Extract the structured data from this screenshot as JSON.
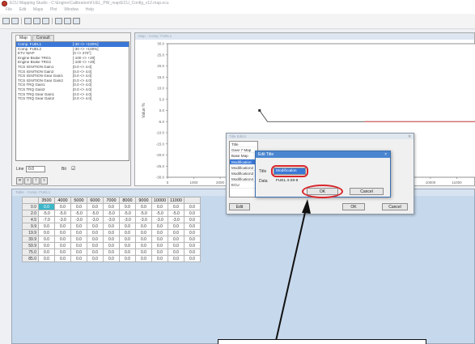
{
  "titlebar": {
    "title": "ECU Mapping Studio - C:\\Engine\\Calibration\\FUEL_PW_map\\ECU_Config_v12.map.ecu"
  },
  "menubar": {
    "items": [
      "File",
      "Edit",
      "Maps",
      "Plot",
      "Window",
      "Help"
    ]
  },
  "left_panel": {
    "tabs": [
      "Map",
      "Consult"
    ],
    "map_list": [
      {
        "name": "Comp. FUEL1",
        "range": "[-30 <> +100%]",
        "selected": true
      },
      {
        "name": "Comp. FUEL2",
        "range": "[-30 <> +100%]"
      },
      {
        "name": "ETV WAP",
        "range": "[0 <> 270°]"
      },
      {
        "name": "Engine Brake TRG1",
        "range": "[-100 <> +20]"
      },
      {
        "name": "Engine Brake TRG2",
        "range": "[-100 <> +20]"
      },
      {
        "name": "TCS IGNITION Gain1",
        "range": "[0.0 <> 4.0]"
      },
      {
        "name": "TCS IGNITION Gain2",
        "range": "[0.0 <> 4.0]"
      },
      {
        "name": "TCS IGNITION Gear Gain1",
        "range": "[0.0 <> 4.0]"
      },
      {
        "name": "TCS IGNITION Gear Gain2",
        "range": "[0.0 <> 4.0]"
      },
      {
        "name": "TCS TRQ Gain1",
        "range": "[0.0 <> 4.0]"
      },
      {
        "name": "TCS TRQ Gain2",
        "range": "[0.0 <> 4.0]"
      },
      {
        "name": "TCS TRQ Gear Gain1",
        "range": "[0.0 <> 4.0]"
      },
      {
        "name": "TCS TRQ Gear Gain2",
        "range": "[0.0 <> 4.0]"
      }
    ],
    "line_label": "Line",
    "line_value": "0.0",
    "bit_label": "Bit",
    "bit_checked": true,
    "buttons": [
      "«",
      "‹",
      "↑",
      "›"
    ]
  },
  "graph": {
    "title": "Map - Comp. FUEL1",
    "ylabel": "Value %",
    "y_ticks": [
      "30.0",
      "25.0",
      "20.0",
      "15.0",
      "10.0",
      "5.0",
      "0.0",
      "-5.0",
      "-10.0",
      "-15.0",
      "-20.0",
      "-25.0",
      "-30.0"
    ],
    "x_ticks": [
      "0",
      "1000",
      "2000",
      "3000",
      "4000",
      "5000",
      "6000",
      "7000",
      "8000",
      "9000",
      "10000",
      "11000",
      "12000"
    ],
    "line_color": "#d94a4a",
    "marker_color": "#333333"
  },
  "table": {
    "title": "Table - Comp. FUEL1",
    "col_headers": [
      "3500",
      "4000",
      "5000",
      "6000",
      "7000",
      "8000",
      "9000",
      "10000",
      "11000",
      ""
    ],
    "rows": [
      {
        "label": "0.0",
        "cells": [
          "0.0",
          "0.0",
          "0.0",
          "0.0",
          "0.0",
          "0.0",
          "0.0",
          "0.0",
          "0.0",
          "0.0"
        ]
      },
      {
        "label": "2.0",
        "cells": [
          "-5.0",
          "-5.0",
          "-5.0",
          "-5.0",
          "-5.0",
          "-5.0",
          "-5.0",
          "-5.0",
          "-5.0",
          "0.0"
        ]
      },
      {
        "label": "4.5",
        "cells": [
          "-7.0",
          "-3.0",
          "-3.0",
          "-3.0",
          "-3.0",
          "-3.0",
          "-3.0",
          "-3.0",
          "-3.0",
          "0.0"
        ]
      },
      {
        "label": "9.9",
        "cells": [
          "0.0",
          "0.0",
          "0.0",
          "0.0",
          "0.0",
          "0.0",
          "0.0",
          "0.0",
          "0.0",
          "0.0"
        ]
      },
      {
        "label": "19.9",
        "cells": [
          "0.0",
          "0.0",
          "0.0",
          "0.0",
          "0.0",
          "0.0",
          "0.0",
          "0.0",
          "0.0",
          "0.0"
        ]
      },
      {
        "label": "39.9",
        "cells": [
          "0.0",
          "0.0",
          "0.0",
          "0.0",
          "0.0",
          "0.0",
          "0.0",
          "0.0",
          "0.0",
          "0.0"
        ]
      },
      {
        "label": "59.9",
        "cells": [
          "0.0",
          "0.0",
          "0.0",
          "0.0",
          "0.0",
          "0.0",
          "0.0",
          "0.0",
          "0.0",
          "0.0"
        ]
      },
      {
        "label": "75.0",
        "cells": [
          "0.0",
          "0.0",
          "0.0",
          "0.0",
          "0.0",
          "0.0",
          "0.0",
          "0.0",
          "0.0",
          "0.0"
        ]
      },
      {
        "label": "85.0",
        "cells": [
          "0.0",
          "0.0",
          "0.0",
          "0.0",
          "0.0",
          "0.0",
          "0.0",
          "0.0",
          "0.0",
          "0.0"
        ]
      }
    ],
    "highlight_color": "#3cb7c8"
  },
  "title_editor": {
    "window_title": "Title Editor",
    "list_header": "Title",
    "items": [
      "Gear 7 Map",
      "Base Map",
      "Modification",
      "Modification2",
      "Modification3",
      "Modification4",
      "ECU"
    ],
    "selected_index": 2,
    "edit_label": "Edit",
    "ok_label": "OK",
    "cancel_label": "Cancel"
  },
  "edit_title": {
    "window_title": "Edit Title",
    "close_label": "×",
    "title_label": "Title",
    "title_value": "Modification",
    "data_label": "Data",
    "data_value": "FUEL 4-29-9",
    "ok_label": "OK",
    "cancel_label": "Cancel"
  },
  "callout": {
    "text": ""
  }
}
